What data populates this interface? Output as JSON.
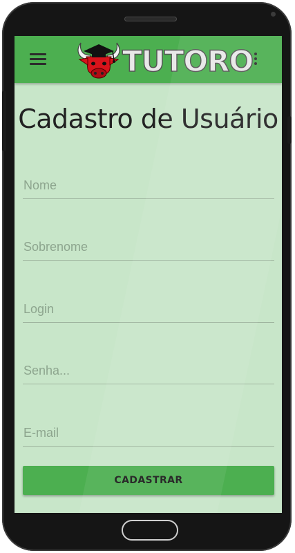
{
  "app": {
    "logo_text": "TUTORO",
    "accent": "#4caf50",
    "screen_bg": "#c8e6c9"
  },
  "toolbar": {
    "menu_icon": "hamburger-menu-icon",
    "more_icon": "more-vert-icon"
  },
  "page": {
    "title": "Cadastro de Usuário"
  },
  "form": {
    "nome_placeholder": "Nome",
    "sobrenome_placeholder": "Sobrenome",
    "login_placeholder": "Login",
    "senha_placeholder": "Senha...",
    "email_placeholder": "E-mail",
    "submit_label": "CADASTRAR"
  }
}
